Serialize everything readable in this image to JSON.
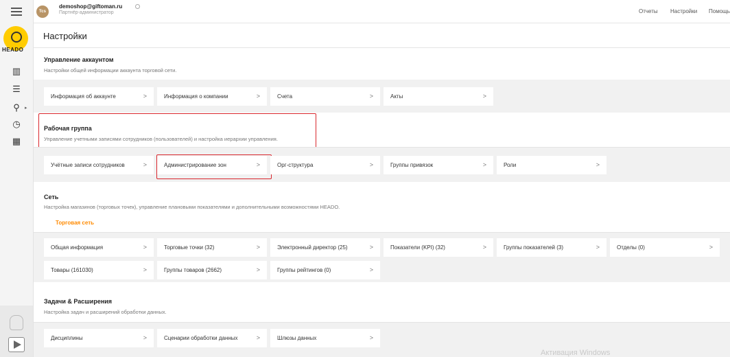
{
  "topbar": {
    "avatar_text": "Tcs",
    "email": "demoshop@giftoman.ru",
    "role": "Партнёр-администратор",
    "links": [
      "Отчеты",
      "Настройки",
      "Помощь"
    ]
  },
  "sidebar": {
    "logo_text": "HEADO",
    "icons": [
      "bar-chart-icon",
      "list-icon",
      "key-icon",
      "clock-icon",
      "calendar-icon"
    ]
  },
  "page": {
    "title": "Настройки"
  },
  "sections": {
    "account": {
      "title": "Управление аккаунтом",
      "desc": "Настройки общей информации аккаунта торговой сети.",
      "cards": [
        "Информация об аккаунте",
        "Информация о компании",
        "Счета",
        "Акты"
      ]
    },
    "workgroup": {
      "title": "Рабочая группа",
      "desc": "Управление учетными записями сотрудников (пользователей) и настройка иерархии управления.",
      "cards": [
        "Учётные записи сотрудников",
        "Администрирование зон",
        "Орг-структура",
        "Группы привязок",
        "Роли"
      ]
    },
    "network": {
      "title": "Сеть",
      "desc": "Настройка магазинов (торговых точек), управление плановыми показателями и дополнительными возможностями HEADO.",
      "tab": "Торговая сеть",
      "cards_row1": [
        "Общая информация",
        "Торговые точки (32)",
        "Электронный директор (25)",
        "Показатели (KPI) (32)",
        "Группы показателей (3)",
        "Отделы (0)"
      ],
      "cards_row2": [
        "Товары (161030)",
        "Группы товаров (2662)",
        "Группы рейтингов (0)"
      ]
    },
    "tasks": {
      "title": "Задачи & Расширения",
      "desc": "Настройка задач и расширений обработки данных.",
      "cards": [
        "Дисциплины",
        "Сценарии обработки данных",
        "Шлюзы данных"
      ]
    }
  },
  "watermark": "Активация Windows",
  "colors": {
    "accent": "#ff8a00",
    "highlight": "#d9262c",
    "logo": "#ffcc00"
  }
}
